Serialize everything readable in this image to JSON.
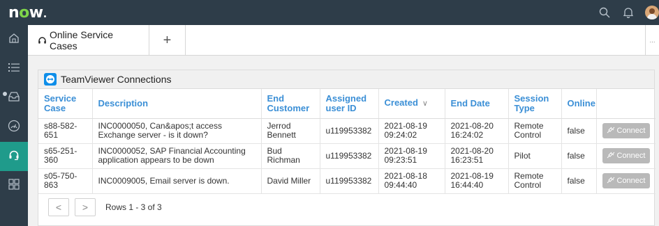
{
  "app": {
    "logo_text": "now",
    "avatar": "user-avatar"
  },
  "tabs": {
    "active_label": "Online Service Cases",
    "add_label": "+",
    "more_label": "..."
  },
  "card": {
    "title": "TeamViewer Connections"
  },
  "table": {
    "columns": [
      "Service Case",
      "Description",
      "End Customer",
      "Assigned user ID",
      "Created",
      "End Date",
      "Session Type",
      "Online",
      ""
    ],
    "sort_indicator": "∨",
    "rows": [
      {
        "service_case": "s88-582-651",
        "description": "INC0000050, Can&apos;t access Exchange server - is it down?",
        "end_customer": "Jerrod Bennett",
        "assigned_user": "u119953382",
        "created": "2021-08-19 09:24:02",
        "end_date": "2021-08-20 16:24:02",
        "session_type": "Remote Control",
        "online": "false",
        "action": "Connect"
      },
      {
        "service_case": "s65-251-360",
        "description": "INC0000052, SAP Financial Accounting application appears to be down",
        "end_customer": "Bud Richman",
        "assigned_user": "u119953382",
        "created": "2021-08-19 09:23:51",
        "end_date": "2021-08-20 16:23:51",
        "session_type": "Pilot",
        "online": "false",
        "action": "Connect"
      },
      {
        "service_case": "s05-750-863",
        "description": "INC0009005, Email server is down.",
        "end_customer": "David Miller",
        "assigned_user": "u119953382",
        "created": "2021-08-18 09:44:40",
        "end_date": "2021-08-19 16:44:40",
        "session_type": "Remote Control",
        "online": "false",
        "action": "Connect"
      }
    ]
  },
  "pager": {
    "prev": "<",
    "next": ">",
    "summary": "Rows 1 - 3 of 3"
  },
  "colors": {
    "topbar": "#2e3d49",
    "accent": "#1f9b8b",
    "header_link": "#3b8fd6",
    "logo_o": "#7fd44a",
    "connect_disabled": "#b9b9b9"
  }
}
